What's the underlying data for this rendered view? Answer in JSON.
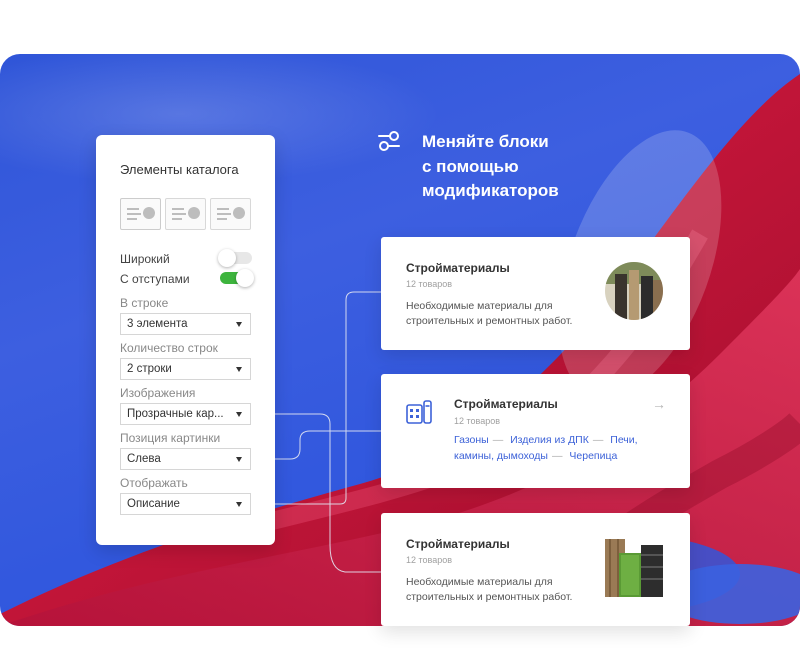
{
  "panel": {
    "title": "Элементы каталога",
    "toggles": [
      {
        "label": "Широкий",
        "on": false
      },
      {
        "label": "С отступами",
        "on": true
      }
    ],
    "fields": [
      {
        "label": "В строке",
        "value": "3 элемента"
      },
      {
        "label": "Количество строк",
        "value": "2 строки"
      },
      {
        "label": "Изображения",
        "value": "Прозрачные кар..."
      },
      {
        "label": "Позиция картинки",
        "value": "Слева"
      },
      {
        "label": "Отображать",
        "value": "Описание"
      }
    ]
  },
  "heading": {
    "line1": "Меняйте блоки",
    "line2": "с помощью",
    "line3": "модификаторов"
  },
  "cards": [
    {
      "title": "Стройматериалы",
      "count": "12 товаров",
      "description": "Необходимые материалы для строительных и ремонтных работ."
    },
    {
      "title": "Стройматериалы",
      "count": "12 товаров",
      "links": [
        "Газоны",
        "Изделия из ДПК",
        "Печи,",
        "камины, дымоходы",
        "Черепица"
      ],
      "arrow": "→"
    },
    {
      "title": "Стройматериалы",
      "count": "12 товаров",
      "description": "Необходимые материалы для строительных и ремонтных работ."
    }
  ],
  "colors": {
    "background_blue": "#3156da",
    "accent_green": "#3db43d",
    "link_blue": "#3d62d8",
    "fabric_red": "#c8193c"
  }
}
